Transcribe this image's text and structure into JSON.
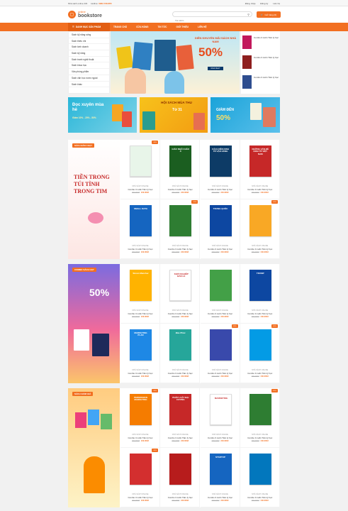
{
  "topbar": {
    "left_prefix": "Hỗ trợ online:",
    "hotline_prefix": "Hotline:",
    "hotline": "0962.738.855",
    "email_label": "Nhà sách online 24h",
    "links": [
      "Đăng nhập",
      "Đăng ký",
      "Liên hệ"
    ]
  },
  "header": {
    "logo_top": "online",
    "logo_bottom": "bookstore",
    "search_placeholder": "Tìm kiếm",
    "cart_label": "Giỏ hàng (0)"
  },
  "nav": {
    "category_label": "DANH MỤC SẢN PHẨM",
    "items": [
      "Trang chủ",
      "Cửa hàng",
      "Tin tức",
      "Giới thiệu",
      "Liên hệ"
    ]
  },
  "sidemenu": [
    "Sách kỹ năng sống",
    "Sách thiếu nhi",
    "Sách kinh doanh",
    "Sách kỹ năng",
    "Sách tranh nghệ thuật",
    "Sách khoa học",
    "Văn phòng phẩm",
    "Sách văn học nước ngoài",
    "Sách khác"
  ],
  "hero": {
    "headline": "DIỄN KHUYẾN MÃI SÁCH NHÀ NAM",
    "percent": "50%",
    "cta": "MUA NGAY"
  },
  "right_ads": [
    {
      "title": "Combo 3 cuốn Tâm lý học"
    },
    {
      "title": "Combo 3 cuốn Tâm lý học"
    },
    {
      "title": "Combo 3 cuốn Tâm lý học"
    }
  ],
  "promos": {
    "p1_title": "Đọc xuyên mùa hè",
    "p1_sub": "Giảm 10% - 20% - 50%",
    "p2_title": "HỘI SÁCH MÙA THU",
    "p2_sub": "Từ 31",
    "p3_title": "GIẢM ĐẾN",
    "p3_pct": "50%"
  },
  "sections": [
    {
      "title": "SÁCH BÁN CHẠY",
      "side_text": "TIỀN TRONG TÚI TÌNH TRONG TIM",
      "products": [
        {
          "cover": "",
          "brand": "NHÀ SÁCH ONLINE",
          "name": "Combo 3 cuốn Tâm lý học",
          "old": "300.000đ",
          "new": "240.000đ",
          "sale": true
        },
        {
          "cover": "GIÁC NGỘ CHÂU Á",
          "brand": "NHÀ SÁCH ONLINE",
          "name": "Combo 3 cuốn Tâm lý học",
          "old": "300.000đ",
          "new": "240.000đ",
          "sale": false
        },
        {
          "cover": "CÁCH NỀN KINH TẾ VẬN HÀNH",
          "brand": "NHÀ SÁCH ONLINE",
          "name": "Combo 3 cuốn Tâm lý học",
          "old": "300.000đ",
          "new": "240.000đ",
          "sale": false
        },
        {
          "cover": "NHỮNG VẤN ĐỀ KINH TẾ VIỆT NAM",
          "brand": "NHÀ SÁCH ONLINE",
          "name": "Combo 3 cuốn Tâm lý học",
          "old": "300.000đ",
          "new": "240.000đ",
          "sale": false
        },
        {
          "cover": "SMALL DATA",
          "brand": "NHÀ SÁCH ONLINE",
          "name": "Combo 3 cuốn Tâm lý học",
          "old": "300.000đ",
          "new": "240.000đ",
          "sale": false
        },
        {
          "cover": "",
          "brand": "NHÀ SÁCH ONLINE",
          "name": "Combo 3 cuốn Tâm lý học",
          "old": "300.000đ",
          "new": "240.000đ",
          "sale": true
        },
        {
          "cover": "TRUNG QUỐC",
          "brand": "NHÀ SÁCH ONLINE",
          "name": "Combo 3 cuốn Tâm lý học",
          "old": "300.000đ",
          "new": "240.000đ",
          "sale": false
        },
        {
          "cover": "",
          "brand": "NHÀ SÁCH ONLINE",
          "name": "Combo 3 cuốn Tâm lý học",
          "old": "300.000đ",
          "new": "240.000đ",
          "sale": true
        }
      ]
    },
    {
      "title": "COMBO SÁCH HAY",
      "side_text": "50%",
      "products": [
        {
          "cover": "Simon Mancher",
          "brand": "NHÀ SÁCH ONLINE",
          "name": "Combo 3 cuốn Tâm lý học",
          "old": "300.000đ",
          "new": "240.000đ",
          "sale": false
        },
        {
          "cover": "KHỞI NGHIỆP BÁN LẺ",
          "brand": "NHÀ SÁCH ONLINE",
          "name": "Combo 3 cuốn Tâm lý học",
          "old": "300.000đ",
          "new": "240.000đ",
          "sale": false
        },
        {
          "cover": "",
          "brand": "NHÀ SÁCH ONLINE",
          "name": "Combo 3 cuốn Tâm lý học",
          "old": "300.000đ",
          "new": "240.000đ",
          "sale": false
        },
        {
          "cover": "TRUMP",
          "brand": "NHÀ SÁCH ONLINE",
          "name": "Combo 3 cuốn Tâm lý học",
          "old": "300.000đ",
          "new": "240.000đ",
          "sale": false
        },
        {
          "cover": "MARKETING PLAN",
          "brand": "NHÀ SÁCH ONLINE",
          "name": "Combo 3 cuốn Tâm lý học",
          "old": "300.000đ",
          "new": "240.000đ",
          "sale": false
        },
        {
          "cover": "Đảo Phúc",
          "brand": "NHÀ SÁCH ONLINE",
          "name": "Combo 3 cuốn Tâm lý học",
          "old": "300.000đ",
          "new": "240.000đ",
          "sale": false
        },
        {
          "cover": "",
          "brand": "NHÀ SÁCH ONLINE",
          "name": "Combo 3 cuốn Tâm lý học",
          "old": "300.000đ",
          "new": "240.000đ",
          "sale": true
        },
        {
          "cover": "",
          "brand": "NHÀ SÁCH ONLINE",
          "name": "Combo 3 cuốn Tâm lý học",
          "old": "300.000đ",
          "new": "240.000đ",
          "sale": true
        }
      ]
    },
    {
      "title": "SÁCH GIẢM GIÁ",
      "side_text": "",
      "products": [
        {
          "cover": "PERMISSION MARKETING",
          "brand": "NHÀ SÁCH ONLINE",
          "name": "Combo 3 cuốn Tâm lý học",
          "old": "300.000đ",
          "new": "240.000đ",
          "sale": true
        },
        {
          "cover": "PHÁP LUẬT ĐẠI CƯƠNG",
          "brand": "NHÀ SÁCH ONLINE",
          "name": "Combo 3 cuốn Tâm lý học",
          "old": "300.000đ",
          "new": "240.000đ",
          "sale": false
        },
        {
          "cover": "MARKETING",
          "brand": "NHÀ SÁCH ONLINE",
          "name": "Combo 3 cuốn Tâm lý học",
          "old": "300.000đ",
          "new": "240.000đ",
          "sale": false
        },
        {
          "cover": "",
          "brand": "NHÀ SÁCH ONLINE",
          "name": "Combo 3 cuốn Tâm lý học",
          "old": "300.000đ",
          "new": "240.000đ",
          "sale": true
        },
        {
          "cover": "",
          "brand": "NHÀ SÁCH ONLINE",
          "name": "Combo 3 cuốn Tâm lý học",
          "old": "300.000đ",
          "new": "240.000đ",
          "sale": true
        },
        {
          "cover": "",
          "brand": "NHÀ SÁCH ONLINE",
          "name": "Combo 3 cuốn Tâm lý học",
          "old": "300.000đ",
          "new": "240.000đ",
          "sale": false
        },
        {
          "cover": "STARTUP",
          "brand": "NHÀ SÁCH ONLINE",
          "name": "Combo 3 cuốn Tâm lý học",
          "old": "300.000đ",
          "new": "240.000đ",
          "sale": false
        },
        {
          "cover": "",
          "brand": "NHÀ SÁCH ONLINE",
          "name": "Combo 3 cuốn Tâm lý học",
          "old": "300.000đ",
          "new": "240.000đ",
          "sale": false
        }
      ]
    }
  ],
  "colors": {
    "accent": "#f26f21",
    "nav": "#f26f21",
    "sale": "#f26f21"
  }
}
